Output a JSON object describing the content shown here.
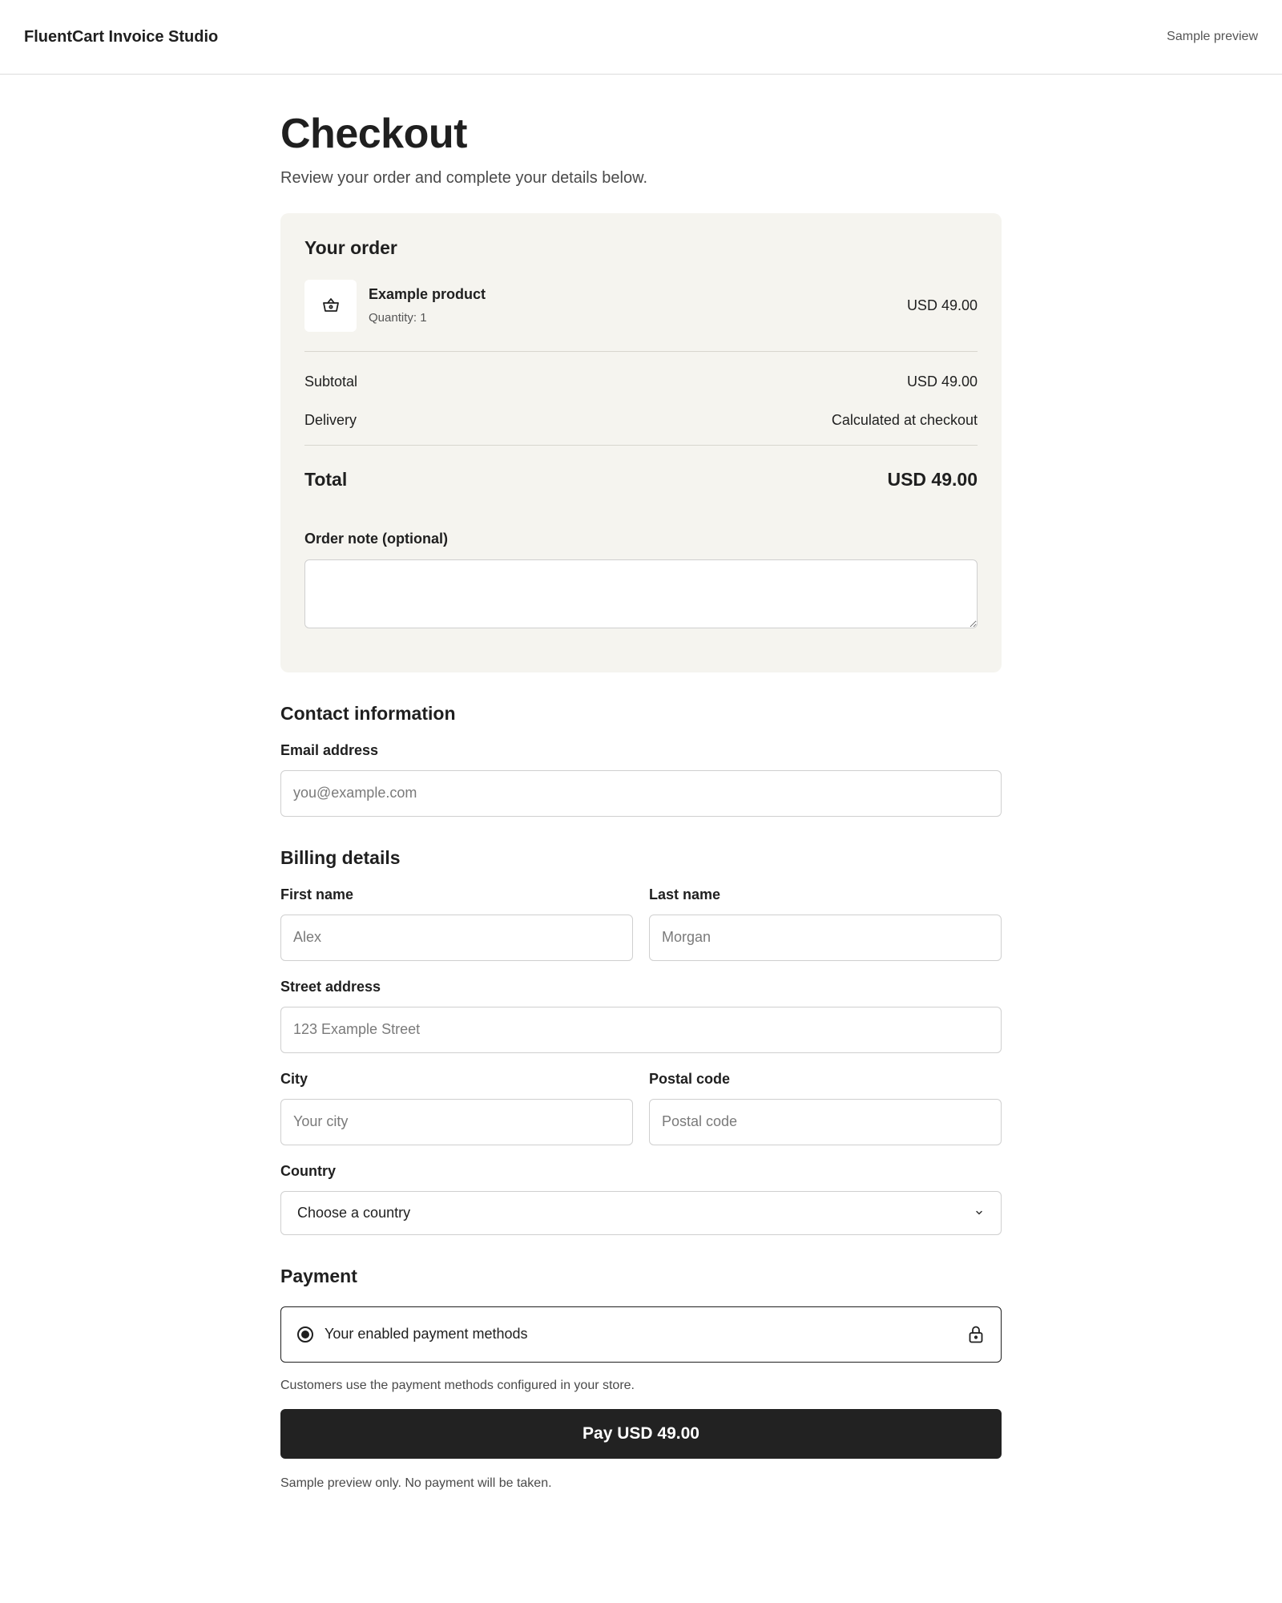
{
  "header": {
    "brand": "FluentCart Invoice Studio",
    "preview_label": "Sample preview"
  },
  "page": {
    "title": "Checkout",
    "subtitle": "Review your order and complete your details below."
  },
  "order": {
    "heading": "Your order",
    "product": {
      "name": "Example product",
      "quantity": "Quantity: 1",
      "price": "USD 49.00",
      "icon": "basket-icon"
    },
    "subtotal_label": "Subtotal",
    "subtotal_value": "USD 49.00",
    "delivery_label": "Delivery",
    "delivery_value": "Calculated at checkout",
    "total_label": "Total",
    "total_value": "USD 49.00",
    "note_label": "Order note (optional)",
    "note_value": ""
  },
  "contact": {
    "heading": "Contact information",
    "email_label": "Email address",
    "email_placeholder": "you@example.com"
  },
  "billing": {
    "heading": "Billing details",
    "first_name_label": "First name",
    "first_name_placeholder": "Alex",
    "last_name_label": "Last name",
    "last_name_placeholder": "Morgan",
    "street_label": "Street address",
    "street_placeholder": "123 Example Street",
    "city_label": "City",
    "city_placeholder": "Your city",
    "postal_label": "Postal code",
    "postal_placeholder": "Postal code",
    "country_label": "Country",
    "country_selected": "Choose a country"
  },
  "payment": {
    "heading": "Payment",
    "method_label": "Your enabled payment methods",
    "help_text": "Customers use the payment methods configured in your store.",
    "pay_button": "Pay USD 49.00",
    "disclaimer": "Sample preview only. No payment will be taken."
  }
}
